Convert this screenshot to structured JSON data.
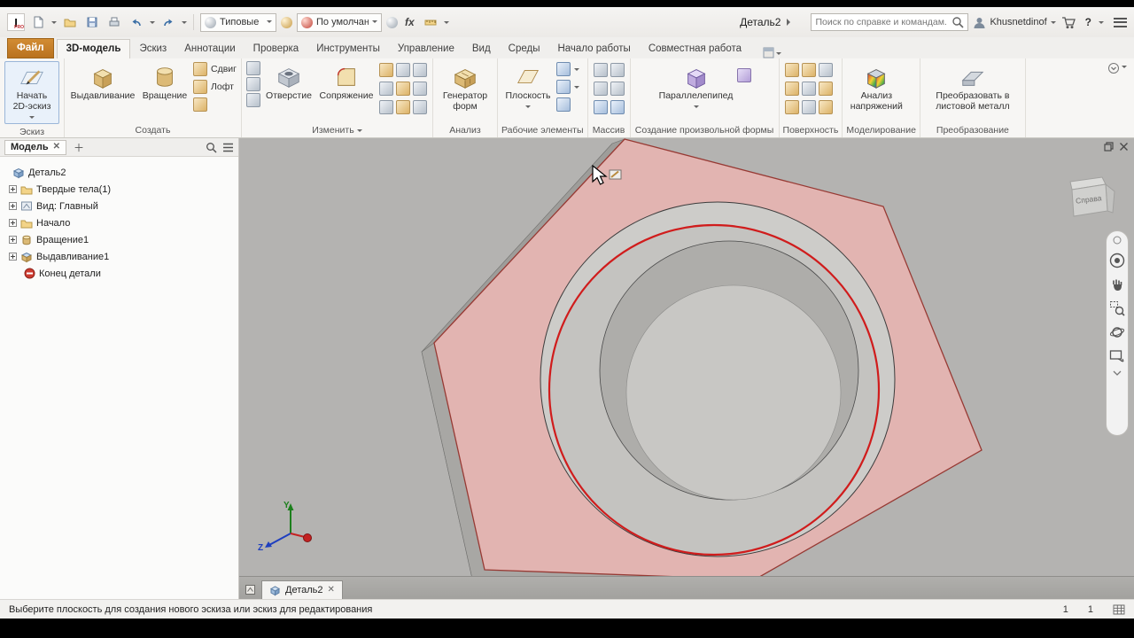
{
  "titlebar": {
    "doc_title": "Деталь2",
    "material_combo": "Типовые",
    "appearance_combo": "По умолчанию",
    "fx_label": "fx",
    "search_placeholder": "Поиск по справке и командам.",
    "user_name": "Khusnetdinof",
    "help_label": "?"
  },
  "tabs": {
    "file": "Файл",
    "model3d": "3D-модель",
    "sketch": "Эскиз",
    "annotations": "Аннотации",
    "inspect": "Проверка",
    "tools": "Инструменты",
    "manage": "Управление",
    "view": "Вид",
    "environments": "Среды",
    "get_started": "Начало работы",
    "collaborate": "Совместная работа"
  },
  "ribbon": {
    "sketch_panel": {
      "start_line1": "Начать",
      "start_line2": "2D-эскиз",
      "label": "Эскиз"
    },
    "create_panel": {
      "extrude": "Выдавливание",
      "revolve": "Вращение",
      "sweep": "Сдвиг",
      "loft": "Лофт",
      "label": "Создать"
    },
    "modify_panel": {
      "hole": "Отверстие",
      "fillet": "Сопряжение",
      "label": "Изменить"
    },
    "explore_panel": {
      "shapegen_line1": "Генератор",
      "shapegen_line2": "форм",
      "label": "Анализ"
    },
    "work_panel": {
      "plane": "Плоскость",
      "label": "Рабочие элементы"
    },
    "pattern_panel": {
      "label": "Массив"
    },
    "freeform_panel": {
      "box": "Параллелепипед",
      "label": "Создание произвольной формы"
    },
    "surface_panel": {
      "label": "Поверхность"
    },
    "simulation_panel": {
      "stress_line1": "Анализ",
      "stress_line2": "напряжений",
      "label": "Моделирование"
    },
    "convert_panel": {
      "sheet_line1": "Преобразовать в",
      "sheet_line2": "листовой металл",
      "label": "Преобразование"
    }
  },
  "browser": {
    "tab_label": "Модель",
    "items": [
      {
        "label": "Деталь2"
      },
      {
        "label": "Твердые тела(1)"
      },
      {
        "label": "Вид: Главный"
      },
      {
        "label": "Начало"
      },
      {
        "label": "Вращение1"
      },
      {
        "label": "Выдавливание1"
      },
      {
        "label": "Конец детали"
      }
    ]
  },
  "viewport": {
    "viewcube_face": "Справа",
    "axis_y": "Y",
    "axis_z": "Z",
    "doc_tab": "Деталь2"
  },
  "statusbar": {
    "message": "Выберите плоскость для создания нового эскиза или эскиз для редактирования",
    "counter1": "1",
    "counter2": "1"
  }
}
